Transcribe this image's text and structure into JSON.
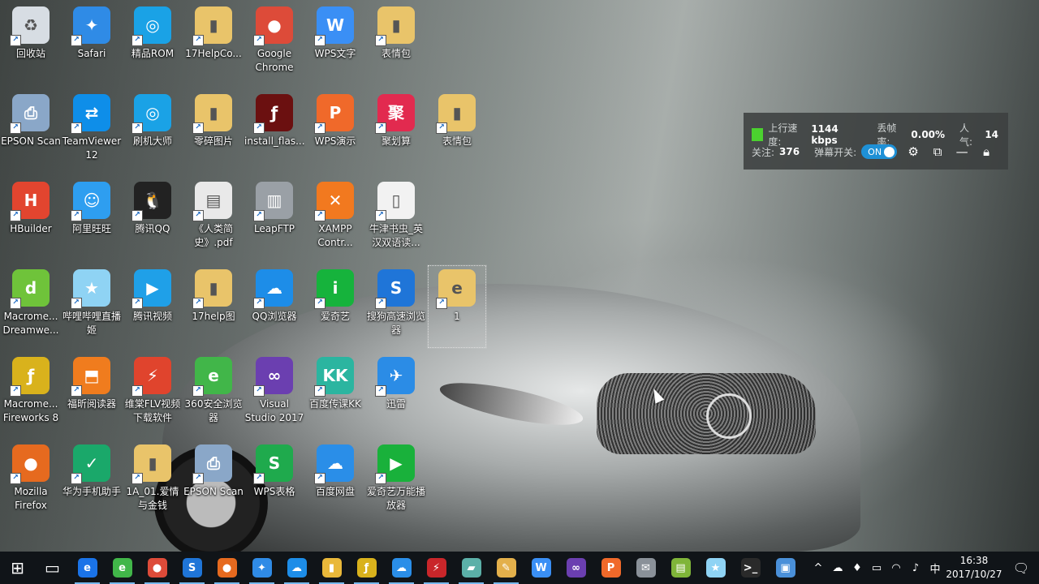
{
  "desktop": {
    "icons": [
      {
        "label": "回收站",
        "icon": "recycle-bin-icon",
        "color": "#d7dde3",
        "glyph": "♻"
      },
      {
        "label": "Safari",
        "icon": "safari-icon",
        "color": "#2f8be6",
        "glyph": "✦"
      },
      {
        "label": "精品ROM",
        "icon": "jingpin-rom-icon",
        "color": "#1aa2e6",
        "glyph": "◎"
      },
      {
        "label": "17HelpCo...",
        "icon": "folder-icon",
        "color": "#e9c46a",
        "glyph": "▮"
      },
      {
        "label": "Google Chrome",
        "icon": "chrome-icon",
        "color": "#dd4b39",
        "glyph": "●"
      },
      {
        "label": "WPS文字",
        "icon": "wps-writer-icon",
        "color": "#3a8ff5",
        "glyph": "W"
      },
      {
        "label": "表情包",
        "icon": "folder-photo-icon",
        "color": "#e9c46a",
        "glyph": "▮"
      },
      {
        "label": "EPSON Scan",
        "icon": "epson-scan-icon",
        "color": "#8aa7c8",
        "glyph": "⎙"
      },
      {
        "label": "TeamViewer 12",
        "icon": "teamviewer-icon",
        "color": "#0e8ee9",
        "glyph": "⇄"
      },
      {
        "label": "刷机大师",
        "icon": "shuaji-dashi-icon",
        "color": "#1aa2e6",
        "glyph": "◎"
      },
      {
        "label": "零碎图片",
        "icon": "folder-icon",
        "color": "#e9c46a",
        "glyph": "▮"
      },
      {
        "label": "install_flas...",
        "icon": "flash-installer-icon",
        "color": "#6b1010",
        "glyph": "ƒ"
      },
      {
        "label": "WPS演示",
        "icon": "wps-presentation-icon",
        "color": "#f0692a",
        "glyph": "P"
      },
      {
        "label": "聚划算",
        "icon": "juhuasuan-icon",
        "color": "#e22a4f",
        "glyph": "聚"
      },
      {
        "label": "表情包",
        "icon": "folder-photo-icon",
        "color": "#e9c46a",
        "glyph": "▮"
      },
      {
        "label": "HBuilder",
        "icon": "hbuilder-icon",
        "color": "#e2452f",
        "glyph": "H"
      },
      {
        "label": "阿里旺旺",
        "icon": "aliwangwang-icon",
        "color": "#2e9ef0",
        "glyph": "☺"
      },
      {
        "label": "腾讯QQ",
        "icon": "qq-icon",
        "color": "#222222",
        "glyph": "🐧"
      },
      {
        "label": "《人类简史》.pdf",
        "icon": "pdf-document-icon",
        "color": "#e9e9e9",
        "glyph": "▤"
      },
      {
        "label": "LeapFTP",
        "icon": "leapftp-icon",
        "color": "#9aa0a6",
        "glyph": "▥"
      },
      {
        "label": "XAMPP Contr...",
        "icon": "xampp-icon",
        "color": "#f2791f",
        "glyph": "✕"
      },
      {
        "label": "牛津书虫_英汉双语读...",
        "icon": "blank-file-icon",
        "color": "#f2f2f2",
        "glyph": "▯"
      },
      {
        "label": "Macrome... Dreamwe...",
        "icon": "dreamweaver-icon",
        "color": "#6fc33a",
        "glyph": "d"
      },
      {
        "label": "哔哩哔哩直播姬",
        "icon": "bilibili-live-icon",
        "color": "#8fd3f4",
        "glyph": "★"
      },
      {
        "label": "腾讯视频",
        "icon": "tencent-video-icon",
        "color": "#1fa0e8",
        "glyph": "▶"
      },
      {
        "label": "17help图",
        "icon": "folder-icon",
        "color": "#e9c46a",
        "glyph": "▮"
      },
      {
        "label": "QQ浏览器",
        "icon": "qq-browser-icon",
        "color": "#1d8de8",
        "glyph": "☁"
      },
      {
        "label": "爱奇艺",
        "icon": "iqiyi-icon",
        "color": "#16b33c",
        "glyph": "i"
      },
      {
        "label": "搜狗高速浏览器",
        "icon": "sogou-browser-icon",
        "color": "#1f75d8",
        "glyph": "S"
      },
      {
        "label": "1",
        "icon": "folder-edge-icon",
        "color": "#e9c46a",
        "glyph": "e"
      },
      {
        "label": "Macrome... Fireworks 8",
        "icon": "fireworks-icon",
        "color": "#d9b21c",
        "glyph": "ƒ"
      },
      {
        "label": "福昕阅读器",
        "icon": "foxit-reader-icon",
        "color": "#f07c1e",
        "glyph": "⬒"
      },
      {
        "label": "维棠FLV视频下载软件",
        "icon": "weitang-flv-icon",
        "color": "#e0442d",
        "glyph": "⚡"
      },
      {
        "label": "360安全浏览器",
        "icon": "360-browser-icon",
        "color": "#41b649",
        "glyph": "e"
      },
      {
        "label": "Visual Studio 2017",
        "icon": "visual-studio-icon",
        "color": "#6b3fb0",
        "glyph": "∞"
      },
      {
        "label": "百度传课KK",
        "icon": "baidu-kk-icon",
        "color": "#2bb5a0",
        "glyph": "KK"
      },
      {
        "label": "迅雷",
        "icon": "xunlei-icon",
        "color": "#2b8ce6",
        "glyph": "✈"
      },
      {
        "label": "Mozilla Firefox",
        "icon": "firefox-icon",
        "color": "#e66a1f",
        "glyph": "●"
      },
      {
        "label": "华为手机助手",
        "icon": "huawei-assistant-icon",
        "color": "#1aa86a",
        "glyph": "✓"
      },
      {
        "label": "1A_01.爱情与金钱",
        "icon": "folder-icon",
        "color": "#e9c46a",
        "glyph": "▮"
      },
      {
        "label": "EPSON Scan",
        "icon": "epson-scan-icon",
        "color": "#8aa7c8",
        "glyph": "⎙"
      },
      {
        "label": "WPS表格",
        "icon": "wps-spreadsheet-icon",
        "color": "#1faa4d",
        "glyph": "S"
      },
      {
        "label": "百度网盘",
        "icon": "baidu-netdisk-icon",
        "color": "#2a8ee8",
        "glyph": "☁"
      },
      {
        "label": "爱奇艺万能播放器",
        "icon": "iqiyi-player-icon",
        "color": "#19b13b",
        "glyph": "▶"
      }
    ]
  },
  "stats_panel": {
    "upload_label": "上行速度:",
    "upload_value": "1144 kbps",
    "drop_label": "丢帧率:",
    "drop_value": "0.00%",
    "popularity_label": "人气:",
    "popularity_value": "14",
    "follow_label": "关注:",
    "follow_value": "376",
    "danmaku_label": "弹幕开关:",
    "toggle_text": "ON",
    "status_color": "#4bd12f",
    "toggle_color": "#1e90d6"
  },
  "taskbar": {
    "apps": [
      {
        "name": "start-button",
        "icon": "windows-logo-icon",
        "glyph": "⊞",
        "color": "transparent"
      },
      {
        "name": "task-view-button",
        "icon": "task-view-icon",
        "glyph": "▭",
        "color": "transparent"
      },
      {
        "name": "taskbar-edge",
        "icon": "edge-icon",
        "glyph": "e",
        "color": "#1a73e8"
      },
      {
        "name": "taskbar-360-browser",
        "icon": "360-browser-icon",
        "glyph": "e",
        "color": "#41b649"
      },
      {
        "name": "taskbar-chrome",
        "icon": "chrome-icon",
        "glyph": "●",
        "color": "#dd4b39"
      },
      {
        "name": "taskbar-sogou",
        "icon": "sogou-browser-icon",
        "glyph": "S",
        "color": "#1f75d8"
      },
      {
        "name": "taskbar-firefox",
        "icon": "firefox-icon",
        "glyph": "●",
        "color": "#e66a1f"
      },
      {
        "name": "taskbar-safari",
        "icon": "safari-icon",
        "glyph": "✦",
        "color": "#2f8be6"
      },
      {
        "name": "taskbar-qq-browser",
        "icon": "qq-browser-icon",
        "glyph": "☁",
        "color": "#1d8de8"
      },
      {
        "name": "taskbar-file-explorer",
        "icon": "folder-icon",
        "glyph": "▮",
        "color": "#e9b83a"
      },
      {
        "name": "taskbar-fireworks",
        "icon": "fireworks-icon",
        "glyph": "ƒ",
        "color": "#d9b21c"
      },
      {
        "name": "taskbar-baidu-netdisk",
        "icon": "baidu-netdisk-icon",
        "glyph": "☁",
        "color": "#2a8ee8"
      },
      {
        "name": "taskbar-app-red",
        "icon": "red-app-icon",
        "glyph": "⚡",
        "color": "#c9262a"
      },
      {
        "name": "taskbar-notes",
        "icon": "notes-icon",
        "glyph": "▰",
        "color": "#5bb0a8"
      },
      {
        "name": "taskbar-paint",
        "icon": "paint-icon",
        "glyph": "✎",
        "color": "#e3b04b"
      },
      {
        "name": "taskbar-wps-writer",
        "icon": "wps-writer-icon",
        "glyph": "W",
        "color": "#3a8ff5"
      },
      {
        "name": "taskbar-visual-studio",
        "icon": "visual-studio-icon",
        "glyph": "∞",
        "color": "#6b3fb0"
      },
      {
        "name": "taskbar-wps-presentation",
        "icon": "wps-presentation-icon",
        "glyph": "P",
        "color": "#f0692a"
      },
      {
        "name": "taskbar-mail",
        "icon": "mail-icon",
        "glyph": "✉",
        "color": "#8a9199"
      },
      {
        "name": "taskbar-notepad",
        "icon": "notepad-icon",
        "glyph": "▤",
        "color": "#7fb539"
      },
      {
        "name": "taskbar-bilibili-live",
        "icon": "bilibili-live-icon",
        "glyph": "★",
        "color": "#8fd3f4"
      },
      {
        "name": "taskbar-terminal",
        "icon": "terminal-icon",
        "glyph": ">_",
        "color": "#2a2a2a"
      },
      {
        "name": "taskbar-remote",
        "icon": "remote-desktop-icon",
        "glyph": "▣",
        "color": "#4a90d9"
      }
    ],
    "tray": [
      {
        "name": "tray-chevron",
        "icon": "chevron-up-icon",
        "glyph": "^"
      },
      {
        "name": "tray-app-1",
        "icon": "cloud-sync-icon",
        "glyph": "☁"
      },
      {
        "name": "tray-qq",
        "icon": "qq-icon",
        "glyph": "♦"
      },
      {
        "name": "tray-battery",
        "icon": "battery-icon",
        "glyph": "▭"
      },
      {
        "name": "tray-wifi",
        "icon": "wifi-icon",
        "glyph": "◠"
      },
      {
        "name": "tray-volume",
        "icon": "volume-icon",
        "glyph": "♪"
      },
      {
        "name": "tray-ime",
        "icon": "ime-icon",
        "glyph": "中"
      }
    ],
    "time": "16:38",
    "date": "2017/10/27"
  }
}
